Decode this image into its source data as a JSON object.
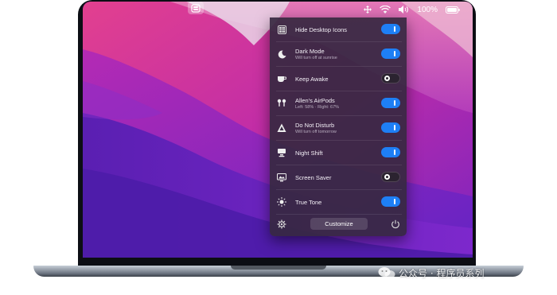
{
  "menubar": {
    "app_icon": "one-switch-icon",
    "icons": [
      "move-icon",
      "wifi-icon",
      "volume-icon"
    ],
    "battery_percent": "100%"
  },
  "panel": {
    "rows": [
      {
        "icon": "desktop-grid-icon",
        "title": "Hide Desktop Icons",
        "subtitle": "",
        "enabled": true
      },
      {
        "icon": "moon-icon",
        "title": "Dark Mode",
        "subtitle": "Will turn off at sunrise",
        "enabled": true
      },
      {
        "icon": "coffee-cup-icon",
        "title": "Keep Awake",
        "subtitle": "",
        "enabled": false
      },
      {
        "icon": "airpods-icon",
        "title": "Allen's AirPods",
        "subtitle": "Left: 58% · Right: 67%",
        "enabled": true
      },
      {
        "icon": "do-not-disturb-icon",
        "title": "Do Not Disturb",
        "subtitle": "Will turn off tomorrow",
        "enabled": true
      },
      {
        "icon": "night-shift-icon",
        "title": "Night Shift",
        "subtitle": "",
        "enabled": true
      },
      {
        "icon": "screen-saver-icon",
        "title": "Screen Saver",
        "subtitle": "",
        "enabled": false
      },
      {
        "icon": "true-tone-icon",
        "title": "True Tone",
        "subtitle": "",
        "enabled": true
      }
    ],
    "customize_label": "Customize",
    "settings_icon": "gear-icon",
    "power_icon": "power-icon"
  },
  "watermark": {
    "text": "公众号 · 程序员系列"
  },
  "colors": {
    "toggle_on": "#1e7ff5",
    "panel_bg": "#362840"
  }
}
